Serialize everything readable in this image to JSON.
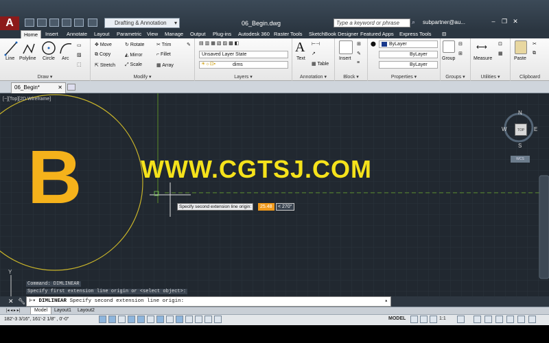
{
  "app": {
    "logo": "A",
    "document_title": "06_Begin.dwg"
  },
  "quick_access": {
    "workspace": "Drafting & Annotation",
    "search_placeholder": "Type a keyword or phrase",
    "user": "subpartner@au..."
  },
  "ribbon_tabs": [
    "Home",
    "Insert",
    "Annotate",
    "Layout",
    "Parametric",
    "View",
    "Manage",
    "Output",
    "Plug-ins",
    "Autodesk 360",
    "Raster Tools",
    "SketchBook Designer",
    "Featured Apps",
    "Express Tools"
  ],
  "active_tab": "Home",
  "panels": {
    "draw": {
      "title": "Draw ▾",
      "tools": [
        "Line",
        "Polyline",
        "Circle",
        "Arc"
      ]
    },
    "modify": {
      "title": "Modify ▾",
      "tools": [
        "Move",
        "Rotate",
        "Trim",
        "Copy",
        "Mirror",
        "Fillet",
        "Stretch",
        "Scale",
        "Array"
      ]
    },
    "layers": {
      "title": "Layers ▾",
      "layer_state": "Unsaved Layer State",
      "current_layer": "dims"
    },
    "annotation": {
      "title": "Annotation ▾",
      "text": "Text",
      "table": "Table"
    },
    "block": {
      "title": "Block ▾",
      "insert": "Insert"
    },
    "properties": {
      "title": "Properties ▾",
      "color": "ByLayer",
      "linetype": "ByLayer",
      "lineweight": "ByLayer"
    },
    "groups": {
      "title": "Groups ▾",
      "group": "Group"
    },
    "utilities": {
      "title": "Utilities ▾",
      "measure": "Measure"
    },
    "clipboard": {
      "title": "Clipboard",
      "paste": "Paste"
    }
  },
  "document_tab": "06_Begin*",
  "viewport": {
    "label": "[−][Top][2D Wireframe]",
    "watermark": "WWW.CGTSJ.COM",
    "drawn_letter": "B",
    "prompt_tooltip": "Specify second extension line origin:",
    "distance_input": "25.48",
    "angle_input": "< 270°",
    "compass": {
      "N": "N",
      "S": "S",
      "E": "E",
      "W": "W",
      "cube": "TOP",
      "wcs": "WCS"
    },
    "ucs_label": "Y"
  },
  "command_history": [
    "Command: DIMLINEAR",
    "Specify first extension line origin or <select object>:"
  ],
  "command_line": {
    "command": "DIMLINEAR",
    "prompt": "Specify second extension line origin:"
  },
  "layout_tabs": [
    "Model",
    "Layout1",
    "Layout2"
  ],
  "status": {
    "coords": "182'-3 3/16\", 161'-2 1/8\" , 0'-0\"",
    "model": "MODEL",
    "scale": "1:1"
  },
  "colors": {
    "canvas": "#212830",
    "accent": "#f5b21b",
    "watermark": "#f5e21b",
    "circle": "#c8b42a"
  }
}
